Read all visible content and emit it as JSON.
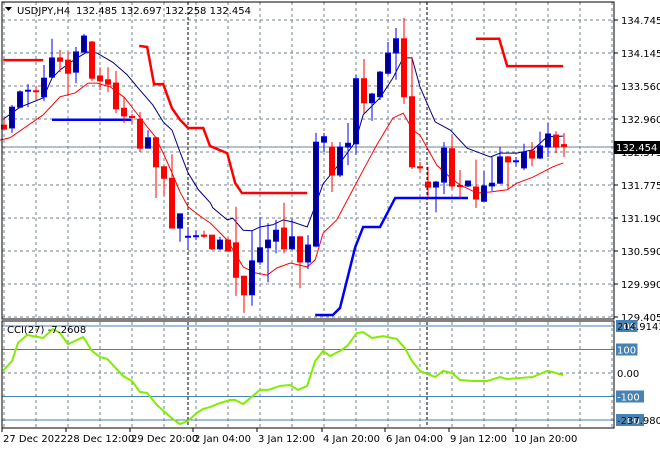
{
  "header": {
    "menu_icon": "triangle-down-icon",
    "symbol": "USDJPY,H4",
    "ohlc": "132.485 132.697 132.258 132.454"
  },
  "price_axis": {
    "labels": [
      "134.745",
      "134.145",
      "133.560",
      "132.960",
      "132.373",
      "131.775",
      "131.190",
      "130.590",
      "129.990",
      "129.405"
    ],
    "current_price": "132.454"
  },
  "cci_panel": {
    "title": "CCI(27) -7.2608",
    "axis_max": "214.9143",
    "axis_min": "-237.9803",
    "levels": [
      "200",
      "100",
      "0.00",
      "-100",
      "-200"
    ]
  },
  "time_axis": {
    "labels": [
      "27 Dec 2022",
      "28 Dec 12:00",
      "29 Dec 20:00",
      "2 Jan 04:00",
      "3 Jan 12:00",
      "4 Jan 20:00",
      "6 Jan 04:00",
      "9 Jan 12:00",
      "10 Jan 20:00"
    ]
  },
  "colors": {
    "bull": "#0000ff",
    "bull_body": "#000080",
    "bear": "#ff0000",
    "ma_fast": "#000080",
    "ma_slow": "#ff0000",
    "cci": "#80ee00",
    "level_line": "#4682b4",
    "grid": "#708090"
  },
  "chart_data": {
    "type": "candlestick",
    "symbol": "USDJPY",
    "timeframe": "H4",
    "ylim": [
      129.405,
      134.745
    ],
    "candles": [
      [
        132.84,
        132.97,
        132.75,
        132.77
      ],
      [
        132.79,
        133.21,
        132.7,
        133.17
      ],
      [
        133.17,
        133.48,
        133.15,
        133.45
      ],
      [
        133.47,
        133.59,
        133.17,
        133.48
      ],
      [
        133.47,
        133.56,
        133.3,
        133.46
      ],
      [
        133.36,
        133.94,
        133.28,
        133.7
      ],
      [
        133.72,
        134.42,
        133.69,
        134.07
      ],
      [
        134.07,
        134.22,
        133.81,
        134.01
      ],
      [
        134.03,
        134.18,
        133.37,
        133.79
      ],
      [
        133.81,
        134.27,
        133.61,
        134.18
      ],
      [
        134.18,
        134.51,
        134.16,
        134.47
      ],
      [
        134.36,
        134.38,
        133.65,
        133.7
      ],
      [
        133.74,
        133.9,
        133.48,
        133.65
      ],
      [
        133.67,
        133.9,
        133.45,
        133.59
      ],
      [
        133.61,
        133.83,
        133.06,
        133.14
      ],
      [
        133.15,
        133.36,
        132.88,
        133.01
      ],
      [
        133.0,
        133.05,
        132.86,
        132.99
      ],
      [
        132.95,
        133.08,
        132.35,
        132.42
      ],
      [
        132.42,
        132.75,
        132.42,
        132.61
      ],
      [
        132.61,
        132.63,
        131.51,
        132.08
      ],
      [
        132.08,
        132.08,
        131.55,
        131.87
      ],
      [
        131.87,
        132.31,
        130.96,
        130.96
      ],
      [
        130.96,
        131.22,
        130.71,
        131.22
      ],
      [
        130.81,
        130.98,
        130.6,
        130.81
      ],
      [
        130.81,
        130.92,
        130.74,
        130.82
      ],
      [
        130.83,
        130.91,
        130.78,
        130.81
      ],
      [
        130.83,
        130.83,
        130.56,
        130.58
      ],
      [
        130.58,
        130.8,
        130.56,
        130.74
      ],
      [
        130.74,
        130.78,
        130.52,
        130.54
      ],
      [
        130.69,
        131.35,
        129.72,
        130.06
      ],
      [
        130.08,
        130.08,
        129.41,
        129.74
      ],
      [
        129.74,
        130.92,
        129.54,
        130.36
      ],
      [
        130.34,
        131.16,
        130.29,
        130.6
      ],
      [
        130.6,
        131.05,
        129.97,
        130.74
      ],
      [
        130.72,
        131.11,
        130.5,
        130.92
      ],
      [
        130.96,
        131.42,
        130.5,
        130.58
      ],
      [
        130.58,
        131.13,
        130.56,
        130.8
      ],
      [
        130.8,
        130.81,
        129.86,
        130.34
      ],
      [
        130.34,
        130.83,
        130.21,
        130.65
      ],
      [
        130.63,
        132.7,
        130.61,
        132.53
      ],
      [
        132.53,
        132.7,
        132.35,
        132.63
      ],
      [
        132.44,
        132.53,
        131.62,
        131.93
      ],
      [
        131.93,
        132.53,
        131.89,
        132.44
      ],
      [
        132.44,
        132.88,
        132.11,
        132.51
      ],
      [
        132.5,
        133.76,
        132.3,
        133.69
      ],
      [
        133.69,
        134.05,
        133.05,
        133.25
      ],
      [
        133.25,
        133.43,
        132.92,
        133.41
      ],
      [
        133.36,
        133.83,
        133.3,
        133.81
      ],
      [
        133.79,
        134.36,
        133.76,
        134.16
      ],
      [
        134.16,
        134.62,
        133.67,
        134.42
      ],
      [
        134.42,
        134.8,
        133.23,
        133.36
      ],
      [
        133.36,
        134.09,
        132.04,
        132.08
      ],
      [
        132.08,
        132.17,
        131.97,
        132.06
      ],
      [
        131.8,
        132.08,
        131.53,
        131.71
      ],
      [
        131.71,
        131.82,
        131.25,
        131.8
      ],
      [
        131.8,
        132.53,
        131.58,
        132.42
      ],
      [
        132.41,
        132.66,
        131.66,
        131.73
      ],
      [
        131.74,
        132.02,
        131.51,
        131.72
      ],
      [
        131.73,
        131.82,
        131.71,
        131.82
      ],
      [
        131.71,
        132.21,
        131.33,
        131.49
      ],
      [
        131.45,
        132.0,
        131.44,
        131.73
      ],
      [
        131.73,
        132.26,
        131.64,
        131.78
      ],
      [
        131.78,
        132.44,
        131.77,
        132.26
      ],
      [
        132.26,
        132.28,
        131.66,
        132.17
      ],
      [
        132.18,
        132.26,
        132.08,
        132.19
      ],
      [
        132.06,
        132.5,
        132.02,
        132.35
      ],
      [
        132.37,
        132.53,
        132.09,
        132.24
      ],
      [
        132.24,
        132.72,
        132.22,
        132.46
      ],
      [
        132.44,
        132.88,
        132.26,
        132.68
      ],
      [
        132.66,
        132.73,
        132.33,
        132.44
      ],
      [
        132.485,
        132.697,
        132.258,
        132.454
      ]
    ],
    "ma_fast": [
      [
        -0.1,
        132.95
      ],
      [
        2,
        133.17
      ],
      [
        4.9,
        133.34
      ],
      [
        6,
        133.7
      ],
      [
        7,
        133.85
      ],
      [
        8.9,
        134.05
      ],
      [
        10.4,
        134.18
      ],
      [
        11.6,
        134.16
      ],
      [
        13.6,
        133.99
      ],
      [
        15.4,
        133.76
      ],
      [
        17,
        133.48
      ],
      [
        18.6,
        133.21
      ],
      [
        19.9,
        132.9
      ],
      [
        21,
        132.75
      ],
      [
        22,
        132.35
      ],
      [
        23,
        131.97
      ],
      [
        24.3,
        131.66
      ],
      [
        25.8,
        131.42
      ],
      [
        26.1,
        131.33
      ],
      [
        27.9,
        131.11
      ],
      [
        28.6,
        131.14
      ],
      [
        29.9,
        130.92
      ],
      [
        31,
        130.91
      ],
      [
        32,
        130.98
      ],
      [
        33.6,
        131.02
      ],
      [
        34.9,
        131.11
      ],
      [
        36.1,
        131.07
      ],
      [
        37.9,
        130.98
      ],
      [
        38.6,
        131.25
      ],
      [
        39.9,
        131.77
      ],
      [
        42,
        132.15
      ],
      [
        43.9,
        132.53
      ],
      [
        44.9,
        133.03
      ],
      [
        47,
        133.34
      ],
      [
        48.6,
        133.7
      ],
      [
        49.9,
        134.07
      ],
      [
        51,
        134.07
      ],
      [
        52,
        133.54
      ],
      [
        53.9,
        132.9
      ],
      [
        55.8,
        132.75
      ],
      [
        57.9,
        132.42
      ],
      [
        60.8,
        132.26
      ],
      [
        62,
        132.33
      ],
      [
        64.1,
        132.33
      ],
      [
        66.1,
        132.39
      ],
      [
        67.9,
        132.63
      ],
      [
        69.9,
        132.64
      ]
    ],
    "ma_slow": [
      [
        -0.5,
        132.57
      ],
      [
        0.75,
        132.61
      ],
      [
        4.9,
        133.03
      ],
      [
        7,
        133.36
      ],
      [
        8.9,
        133.43
      ],
      [
        10.5,
        133.61
      ],
      [
        11.6,
        133.61
      ],
      [
        13.3,
        133.54
      ],
      [
        15.1,
        133.34
      ],
      [
        16.1,
        133.15
      ],
      [
        17.9,
        132.81
      ],
      [
        18.9,
        132.63
      ],
      [
        19.9,
        132.33
      ],
      [
        21,
        131.97
      ],
      [
        22,
        131.62
      ],
      [
        23,
        131.35
      ],
      [
        24.5,
        131.18
      ],
      [
        25.8,
        131.05
      ],
      [
        27.9,
        130.74
      ],
      [
        29.9,
        130.25
      ],
      [
        31.4,
        130.14
      ],
      [
        32.9,
        130.1
      ],
      [
        34.1,
        130.23
      ],
      [
        35.8,
        130.32
      ],
      [
        37.9,
        130.25
      ],
      [
        38.9,
        130.38
      ],
      [
        39.9,
        130.87
      ],
      [
        41.6,
        131.11
      ],
      [
        43.6,
        131.66
      ],
      [
        44.9,
        132.02
      ],
      [
        46.6,
        132.48
      ],
      [
        48.6,
        132.97
      ],
      [
        49.9,
        133.06
      ],
      [
        51.1,
        132.75
      ],
      [
        52,
        132.66
      ],
      [
        54.1,
        132.11
      ],
      [
        55.75,
        131.89
      ],
      [
        57,
        131.75
      ],
      [
        59.1,
        131.6
      ],
      [
        60.75,
        131.62
      ],
      [
        62.9,
        131.66
      ],
      [
        64.1,
        131.78
      ],
      [
        66.1,
        131.89
      ],
      [
        68.6,
        132.08
      ],
      [
        69.9,
        132.15
      ]
    ],
    "resistance": [
      [
        [
          -0.1,
          134.03
        ],
        [
          4.9,
          134.03
        ]
      ],
      [
        [
          16.9,
          134.29
        ],
        [
          17.9,
          134.27
        ],
        [
          18.75,
          133.59
        ],
        [
          19.9,
          133.59
        ],
        [
          21,
          133.15
        ],
        [
          22,
          132.94
        ],
        [
          23,
          132.79
        ],
        [
          24.9,
          132.79
        ],
        [
          25.75,
          132.46
        ],
        [
          27.9,
          132.33
        ],
        [
          28.9,
          131.78
        ],
        [
          29.75,
          131.6
        ],
        [
          37.9,
          131.6
        ]
      ],
      [
        [
          59,
          134.42
        ],
        [
          61.9,
          134.42
        ],
        [
          62.9,
          133.92
        ],
        [
          69.9,
          133.92
        ]
      ]
    ],
    "support": [
      [
        [
          6,
          132.94
        ],
        [
          15.9,
          132.94
        ]
      ],
      [
        [
          38.9,
          129.37
        ],
        [
          41.1,
          129.37
        ],
        [
          42,
          129.5
        ],
        [
          43.9,
          130.61
        ],
        [
          44.9,
          130.98
        ],
        [
          47,
          130.98
        ],
        [
          48.9,
          131.51
        ],
        [
          58,
          131.51
        ]
      ]
    ],
    "cci": [
      [
        -0.1,
        10
      ],
      [
        1,
        51
      ],
      [
        1.75,
        128
      ],
      [
        2.9,
        162
      ],
      [
        3.6,
        157
      ],
      [
        4.9,
        149
      ],
      [
        6.1,
        187
      ],
      [
        7,
        170
      ],
      [
        8,
        123
      ],
      [
        9.9,
        153
      ],
      [
        11,
        94
      ],
      [
        12,
        68
      ],
      [
        12.9,
        60
      ],
      [
        14.9,
        -13
      ],
      [
        16,
        -34
      ],
      [
        17,
        -81
      ],
      [
        17.9,
        -85
      ],
      [
        19.1,
        -136
      ],
      [
        21.1,
        -196
      ],
      [
        22,
        -217
      ],
      [
        23,
        -204
      ],
      [
        24.1,
        -170
      ],
      [
        24.9,
        -153
      ],
      [
        25.75,
        -145
      ],
      [
        27,
        -128
      ],
      [
        28.25,
        -115
      ],
      [
        28.9,
        -115
      ],
      [
        29.9,
        -132
      ],
      [
        32,
        -72
      ],
      [
        33,
        -72
      ],
      [
        34.5,
        -55
      ],
      [
        35.75,
        -51
      ],
      [
        36.75,
        -72
      ],
      [
        37.9,
        -55
      ],
      [
        38.9,
        51
      ],
      [
        39.9,
        94
      ],
      [
        40.75,
        72
      ],
      [
        42,
        94
      ],
      [
        42.9,
        115
      ],
      [
        44.1,
        170
      ],
      [
        44.9,
        174
      ],
      [
        46,
        149
      ],
      [
        47.4,
        157
      ],
      [
        49.1,
        145
      ],
      [
        50.1,
        106
      ],
      [
        51,
        51
      ],
      [
        52,
        9
      ],
      [
        53.9,
        -17
      ],
      [
        54.9,
        9
      ],
      [
        56,
        0
      ],
      [
        57,
        -30
      ],
      [
        58.6,
        -34
      ],
      [
        60.4,
        -34
      ],
      [
        62,
        -17
      ],
      [
        62.9,
        -26
      ],
      [
        64.5,
        -21
      ],
      [
        66.1,
        -17
      ],
      [
        67.9,
        9
      ],
      [
        68.6,
        4
      ],
      [
        69.9,
        -9
      ]
    ]
  }
}
